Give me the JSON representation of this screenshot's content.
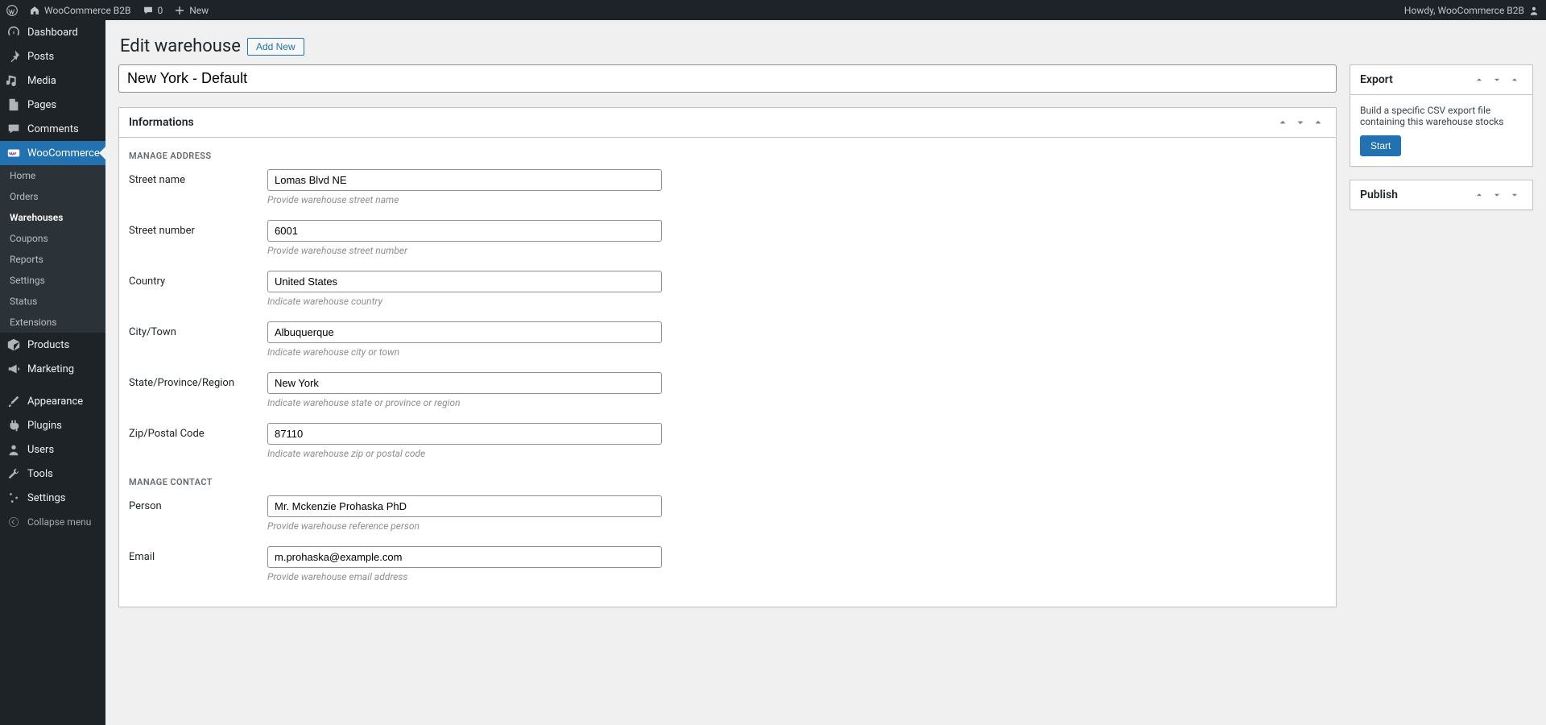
{
  "adminbar": {
    "site_name": "WooCommerce B2B",
    "comments_count": "0",
    "new_label": "New",
    "greeting": "Howdy, WooCommerce B2B"
  },
  "sidebar": {
    "items": [
      {
        "id": "dashboard",
        "label": "Dashboard"
      },
      {
        "id": "posts",
        "label": "Posts"
      },
      {
        "id": "media",
        "label": "Media"
      },
      {
        "id": "pages",
        "label": "Pages"
      },
      {
        "id": "comments",
        "label": "Comments"
      }
    ],
    "woocommerce_label": "WooCommerce",
    "woocommerce_sub": [
      {
        "label": "Home"
      },
      {
        "label": "Orders"
      },
      {
        "label": "Warehouses",
        "current": true
      },
      {
        "label": "Coupons"
      },
      {
        "label": "Reports"
      },
      {
        "label": "Settings"
      },
      {
        "label": "Status"
      },
      {
        "label": "Extensions"
      }
    ],
    "items2": [
      {
        "id": "products",
        "label": "Products"
      },
      {
        "id": "marketing",
        "label": "Marketing"
      }
    ],
    "items3": [
      {
        "id": "appearance",
        "label": "Appearance"
      },
      {
        "id": "plugins",
        "label": "Plugins"
      },
      {
        "id": "users",
        "label": "Users"
      },
      {
        "id": "tools",
        "label": "Tools"
      },
      {
        "id": "settings",
        "label": "Settings"
      }
    ],
    "collapse_label": "Collapse menu"
  },
  "page": {
    "title": "Edit warehouse",
    "add_new": "Add New",
    "warehouse_title": "New York - Default"
  },
  "infobox": {
    "title": "Informations",
    "section_address": "Manage address",
    "section_contact": "Manage contact",
    "fields": {
      "street_name": {
        "label": "Street name",
        "value": "Lomas Blvd NE",
        "help": "Provide warehouse street name"
      },
      "street_number": {
        "label": "Street number",
        "value": "6001",
        "help": "Provide warehouse street number"
      },
      "country": {
        "label": "Country",
        "value": "United States",
        "help": "Indicate warehouse country"
      },
      "city": {
        "label": "City/Town",
        "value": "Albuquerque",
        "help": "Indicate warehouse city or town"
      },
      "state": {
        "label": "State/Province/Region",
        "value": "New York",
        "help": "Indicate warehouse state or province or region"
      },
      "zip": {
        "label": "Zip/Postal Code",
        "value": "87110",
        "help": "Indicate warehouse zip or postal code"
      },
      "person": {
        "label": "Person",
        "value": "Mr. Mckenzie Prohaska PhD",
        "help": "Provide warehouse reference person"
      },
      "email": {
        "label": "Email",
        "value": "m.prohaska@example.com",
        "help": "Provide warehouse email address"
      }
    }
  },
  "export": {
    "title": "Export",
    "desc": "Build a specific CSV export file containing this warehouse stocks",
    "start": "Start"
  },
  "publish": {
    "title": "Publish"
  }
}
